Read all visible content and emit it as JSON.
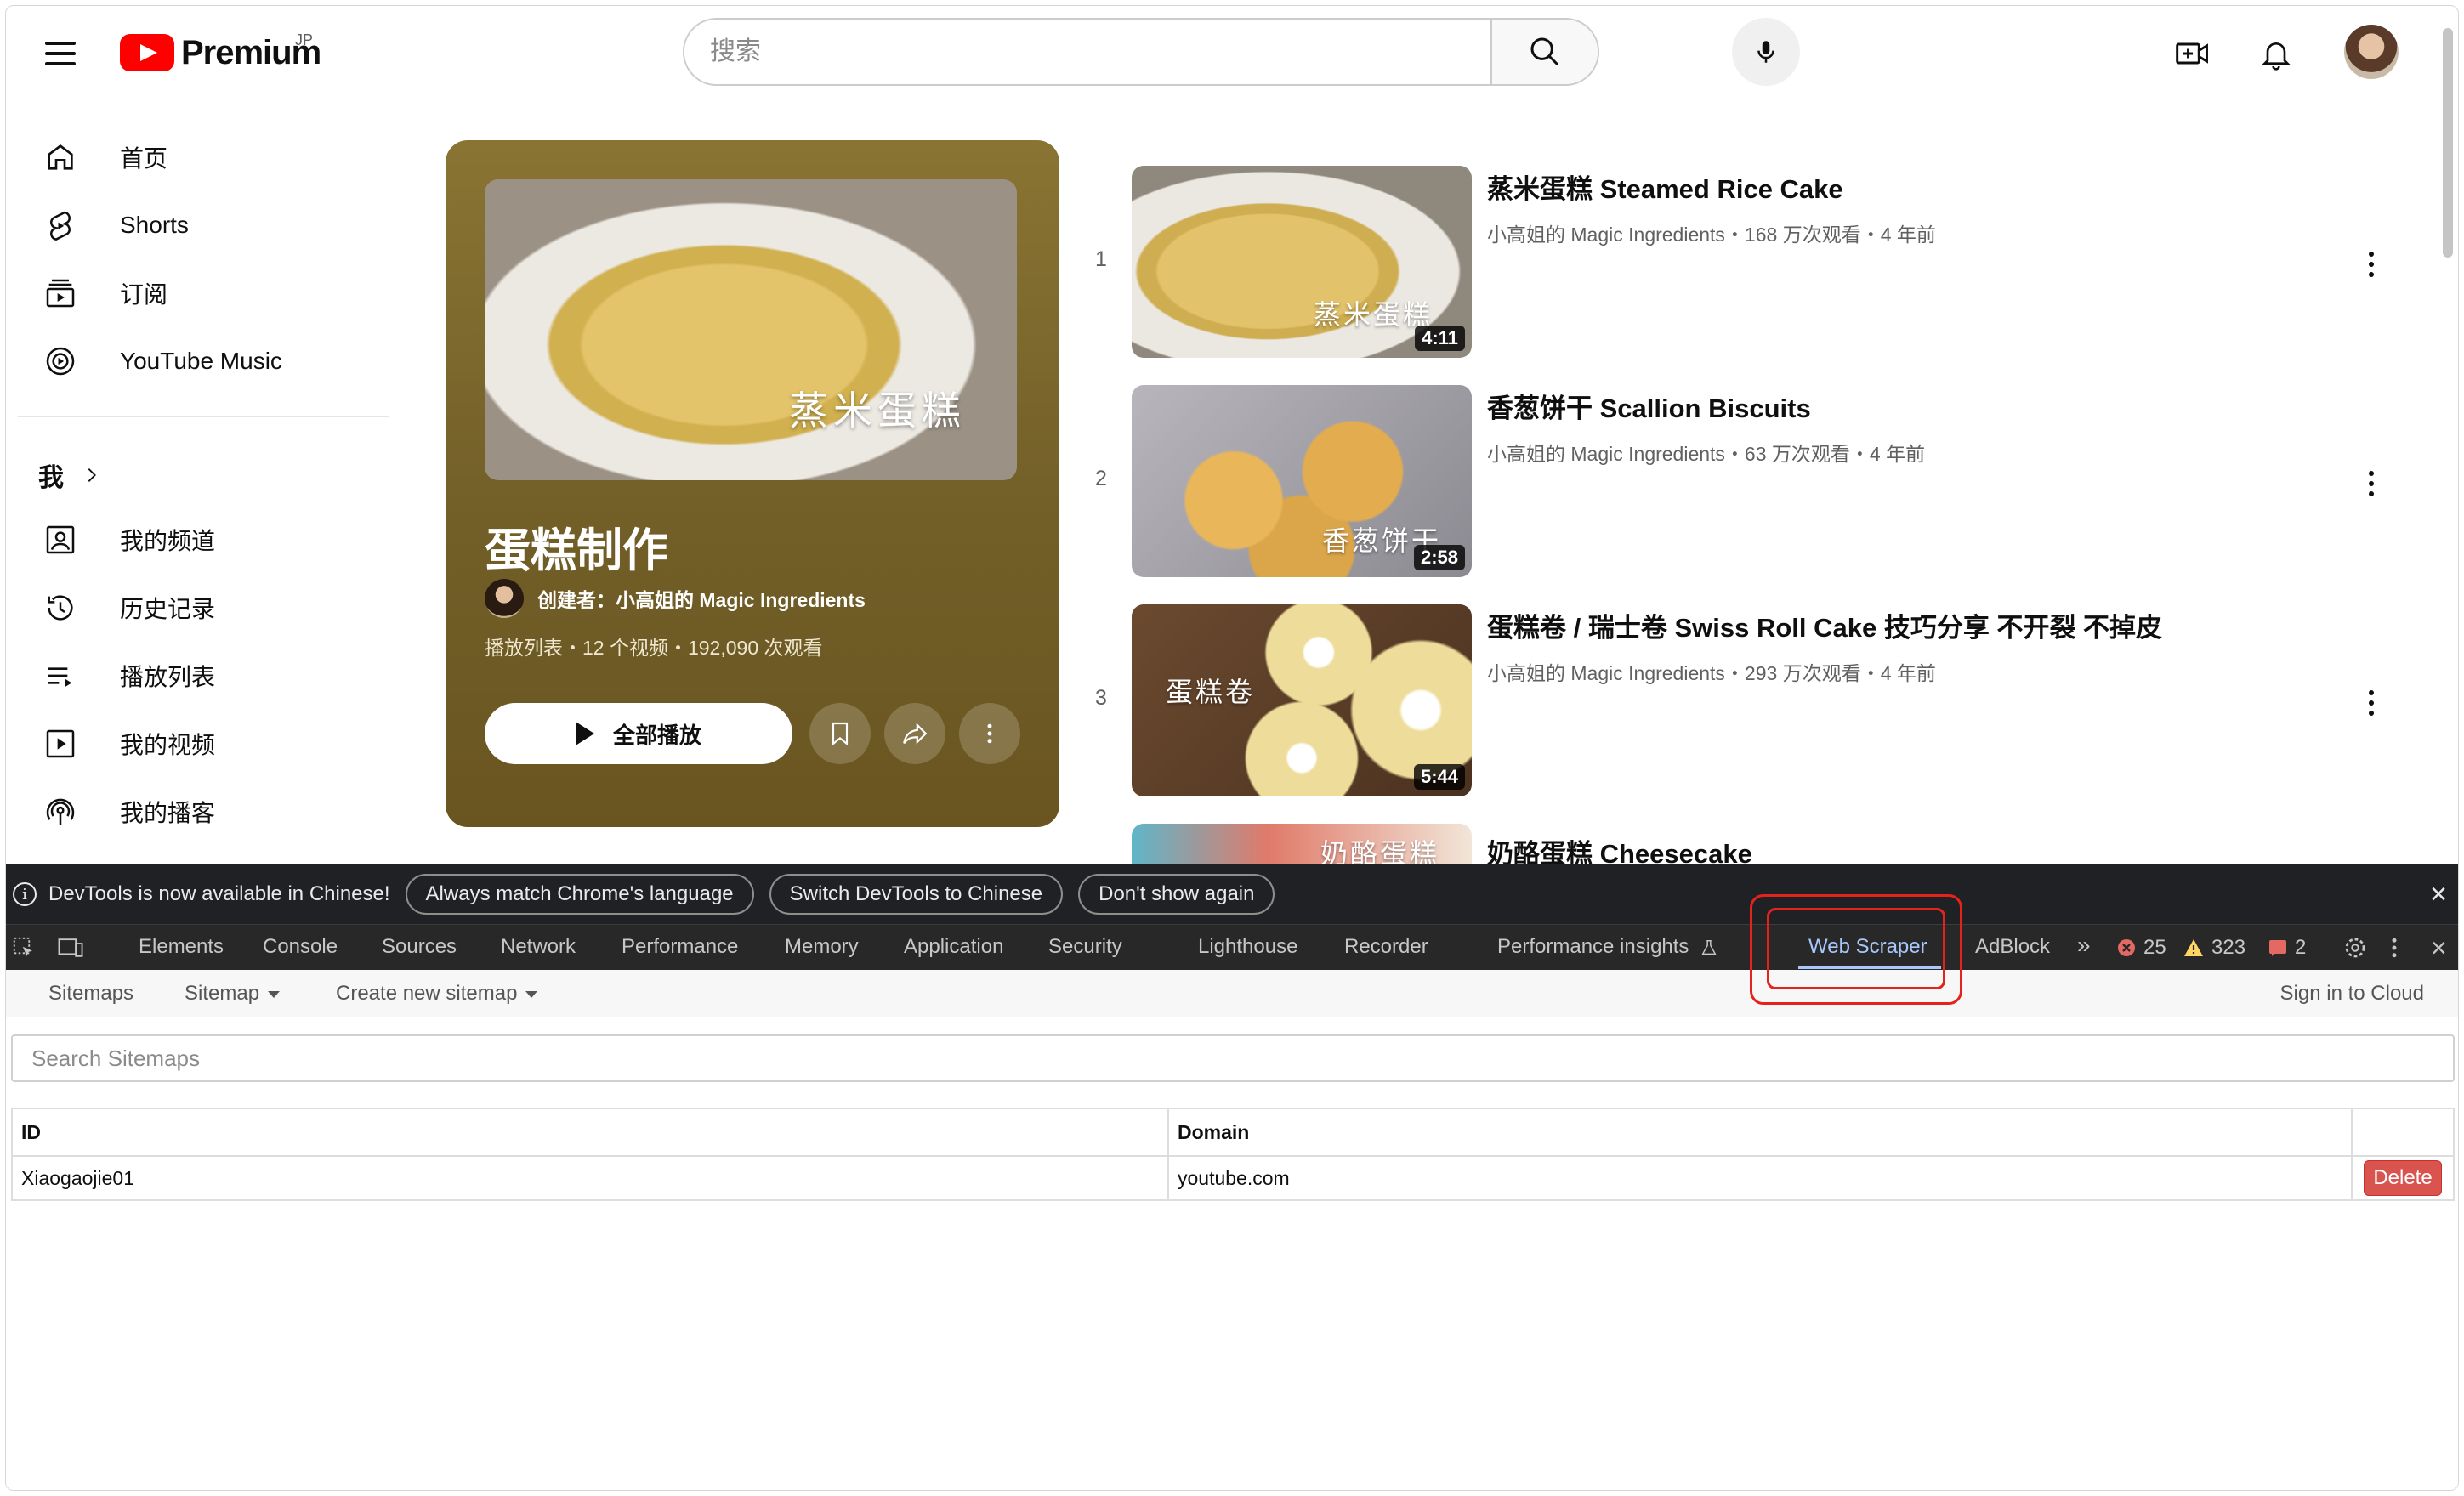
{
  "header": {
    "logo_text": "Premium",
    "logo_region": "JP",
    "search_placeholder": "搜索"
  },
  "sidebar": {
    "items": [
      {
        "label": "首页",
        "icon": "home-icon"
      },
      {
        "label": "Shorts",
        "icon": "shorts-icon"
      },
      {
        "label": "订阅",
        "icon": "subscriptions-icon"
      },
      {
        "label": "YouTube Music",
        "icon": "youtube-music-icon"
      }
    ],
    "me_label": "我",
    "me_items": [
      {
        "label": "我的频道",
        "icon": "your-channel-icon"
      },
      {
        "label": "历史记录",
        "icon": "history-icon"
      },
      {
        "label": "播放列表",
        "icon": "playlists-icon"
      },
      {
        "label": "我的视频",
        "icon": "your-videos-icon"
      },
      {
        "label": "我的播客",
        "icon": "podcasts-icon"
      }
    ]
  },
  "playlist": {
    "thumb_text": "蒸米蛋糕",
    "title": "蛋糕制作",
    "creator": "创建者：小高姐的 Magic Ingredients",
    "meta": "播放列表・12 个视频・192,090 次观看",
    "play_all": "全部播放"
  },
  "videos": [
    {
      "index": "1",
      "title": "蒸米蛋糕 Steamed Rice Cake",
      "sub": "小高姐的 Magic Ingredients・168 万次观看・4 年前",
      "duration": "4:11",
      "thumb_text": "蒸米蛋糕"
    },
    {
      "index": "2",
      "title": "香葱饼干 Scallion Biscuits",
      "sub": "小高姐的 Magic Ingredients・63 万次观看・4 年前",
      "duration": "2:58",
      "thumb_text": "香葱饼干"
    },
    {
      "index": "3",
      "title": "蛋糕卷 / 瑞士卷 Swiss Roll Cake 技巧分享 不开裂 不掉皮",
      "sub": "小高姐的 Magic Ingredients・293 万次观看・4 年前",
      "duration": "5:44",
      "thumb_text": "蛋糕卷"
    },
    {
      "index": "",
      "title": "奶酪蛋糕 Cheesecake",
      "sub": "",
      "duration": "",
      "thumb_text": "奶酪蛋糕"
    }
  ],
  "devtools": {
    "banner_msg": "DevTools is now available in Chinese!",
    "banner_buttons": [
      "Always match Chrome's language",
      "Switch DevTools to Chinese",
      "Don't show again"
    ],
    "tabs": [
      "Elements",
      "Console",
      "Sources",
      "Network",
      "Performance",
      "Memory",
      "Application",
      "Security",
      "Lighthouse",
      "Recorder",
      "Performance insights",
      "Web Scraper",
      "AdBlock"
    ],
    "active_tab": "Web Scraper",
    "errors": "25",
    "warnings": "323",
    "issues": "2",
    "subnav": {
      "sitemaps": "Sitemaps",
      "sitemap": "Sitemap",
      "create": "Create new sitemap",
      "sign_in": "Sign in to Cloud"
    },
    "search_placeholder": "Search Sitemaps",
    "table": {
      "headers": [
        "ID",
        "Domain"
      ],
      "rows": [
        {
          "id": "Xiaogaojie01",
          "domain": "youtube.com",
          "action": "Delete"
        }
      ]
    }
  },
  "colors": {
    "brand_red": "#ff0000",
    "devtools_bg": "#202124",
    "active_tab": "#a8c7fa",
    "highlight": "#e3231c",
    "delete": "#d9534f"
  }
}
